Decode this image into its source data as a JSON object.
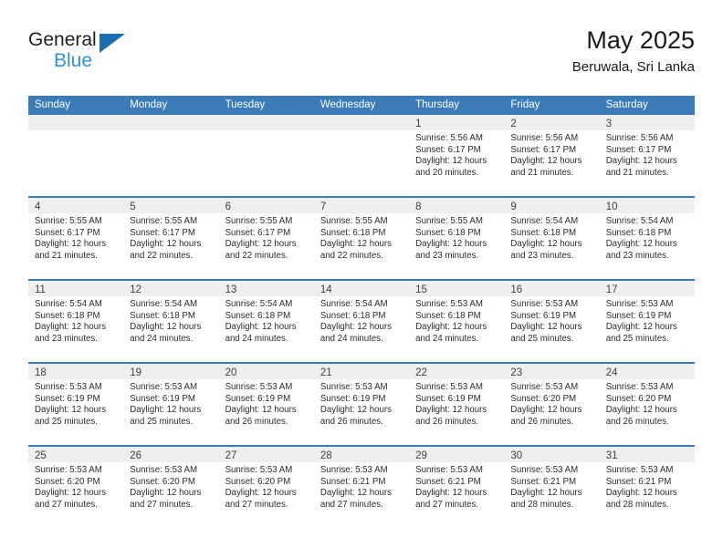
{
  "brand": {
    "line1": "General",
    "line2": "Blue",
    "triangle_color": "#1b6cb0",
    "blue_text_color": "#2e8fd6"
  },
  "header": {
    "title": "May 2025",
    "subtitle": "Beruwala, Sri Lanka"
  },
  "colors": {
    "header_row_bg": "#3b7cb8",
    "header_row_text": "#ffffff",
    "day_strip_bg": "#efefef",
    "cell_bg": "#ffffff",
    "body_text": "#2b2b2b"
  },
  "weekdays": [
    "Sunday",
    "Monday",
    "Tuesday",
    "Wednesday",
    "Thursday",
    "Friday",
    "Saturday"
  ],
  "weeks": [
    [
      {
        "day": "",
        "lines": []
      },
      {
        "day": "",
        "lines": []
      },
      {
        "day": "",
        "lines": []
      },
      {
        "day": "",
        "lines": []
      },
      {
        "day": "1",
        "lines": [
          "Sunrise: 5:56 AM",
          "Sunset: 6:17 PM",
          "Daylight: 12 hours",
          "and 20 minutes."
        ]
      },
      {
        "day": "2",
        "lines": [
          "Sunrise: 5:56 AM",
          "Sunset: 6:17 PM",
          "Daylight: 12 hours",
          "and 21 minutes."
        ]
      },
      {
        "day": "3",
        "lines": [
          "Sunrise: 5:56 AM",
          "Sunset: 6:17 PM",
          "Daylight: 12 hours",
          "and 21 minutes."
        ]
      }
    ],
    [
      {
        "day": "4",
        "lines": [
          "Sunrise: 5:55 AM",
          "Sunset: 6:17 PM",
          "Daylight: 12 hours",
          "and 21 minutes."
        ]
      },
      {
        "day": "5",
        "lines": [
          "Sunrise: 5:55 AM",
          "Sunset: 6:17 PM",
          "Daylight: 12 hours",
          "and 22 minutes."
        ]
      },
      {
        "day": "6",
        "lines": [
          "Sunrise: 5:55 AM",
          "Sunset: 6:17 PM",
          "Daylight: 12 hours",
          "and 22 minutes."
        ]
      },
      {
        "day": "7",
        "lines": [
          "Sunrise: 5:55 AM",
          "Sunset: 6:18 PM",
          "Daylight: 12 hours",
          "and 22 minutes."
        ]
      },
      {
        "day": "8",
        "lines": [
          "Sunrise: 5:55 AM",
          "Sunset: 6:18 PM",
          "Daylight: 12 hours",
          "and 23 minutes."
        ]
      },
      {
        "day": "9",
        "lines": [
          "Sunrise: 5:54 AM",
          "Sunset: 6:18 PM",
          "Daylight: 12 hours",
          "and 23 minutes."
        ]
      },
      {
        "day": "10",
        "lines": [
          "Sunrise: 5:54 AM",
          "Sunset: 6:18 PM",
          "Daylight: 12 hours",
          "and 23 minutes."
        ]
      }
    ],
    [
      {
        "day": "11",
        "lines": [
          "Sunrise: 5:54 AM",
          "Sunset: 6:18 PM",
          "Daylight: 12 hours",
          "and 23 minutes."
        ]
      },
      {
        "day": "12",
        "lines": [
          "Sunrise: 5:54 AM",
          "Sunset: 6:18 PM",
          "Daylight: 12 hours",
          "and 24 minutes."
        ]
      },
      {
        "day": "13",
        "lines": [
          "Sunrise: 5:54 AM",
          "Sunset: 6:18 PM",
          "Daylight: 12 hours",
          "and 24 minutes."
        ]
      },
      {
        "day": "14",
        "lines": [
          "Sunrise: 5:54 AM",
          "Sunset: 6:18 PM",
          "Daylight: 12 hours",
          "and 24 minutes."
        ]
      },
      {
        "day": "15",
        "lines": [
          "Sunrise: 5:53 AM",
          "Sunset: 6:18 PM",
          "Daylight: 12 hours",
          "and 24 minutes."
        ]
      },
      {
        "day": "16",
        "lines": [
          "Sunrise: 5:53 AM",
          "Sunset: 6:19 PM",
          "Daylight: 12 hours",
          "and 25 minutes."
        ]
      },
      {
        "day": "17",
        "lines": [
          "Sunrise: 5:53 AM",
          "Sunset: 6:19 PM",
          "Daylight: 12 hours",
          "and 25 minutes."
        ]
      }
    ],
    [
      {
        "day": "18",
        "lines": [
          "Sunrise: 5:53 AM",
          "Sunset: 6:19 PM",
          "Daylight: 12 hours",
          "and 25 minutes."
        ]
      },
      {
        "day": "19",
        "lines": [
          "Sunrise: 5:53 AM",
          "Sunset: 6:19 PM",
          "Daylight: 12 hours",
          "and 25 minutes."
        ]
      },
      {
        "day": "20",
        "lines": [
          "Sunrise: 5:53 AM",
          "Sunset: 6:19 PM",
          "Daylight: 12 hours",
          "and 26 minutes."
        ]
      },
      {
        "day": "21",
        "lines": [
          "Sunrise: 5:53 AM",
          "Sunset: 6:19 PM",
          "Daylight: 12 hours",
          "and 26 minutes."
        ]
      },
      {
        "day": "22",
        "lines": [
          "Sunrise: 5:53 AM",
          "Sunset: 6:19 PM",
          "Daylight: 12 hours",
          "and 26 minutes."
        ]
      },
      {
        "day": "23",
        "lines": [
          "Sunrise: 5:53 AM",
          "Sunset: 6:20 PM",
          "Daylight: 12 hours",
          "and 26 minutes."
        ]
      },
      {
        "day": "24",
        "lines": [
          "Sunrise: 5:53 AM",
          "Sunset: 6:20 PM",
          "Daylight: 12 hours",
          "and 26 minutes."
        ]
      }
    ],
    [
      {
        "day": "25",
        "lines": [
          "Sunrise: 5:53 AM",
          "Sunset: 6:20 PM",
          "Daylight: 12 hours",
          "and 27 minutes."
        ]
      },
      {
        "day": "26",
        "lines": [
          "Sunrise: 5:53 AM",
          "Sunset: 6:20 PM",
          "Daylight: 12 hours",
          "and 27 minutes."
        ]
      },
      {
        "day": "27",
        "lines": [
          "Sunrise: 5:53 AM",
          "Sunset: 6:20 PM",
          "Daylight: 12 hours",
          "and 27 minutes."
        ]
      },
      {
        "day": "28",
        "lines": [
          "Sunrise: 5:53 AM",
          "Sunset: 6:21 PM",
          "Daylight: 12 hours",
          "and 27 minutes."
        ]
      },
      {
        "day": "29",
        "lines": [
          "Sunrise: 5:53 AM",
          "Sunset: 6:21 PM",
          "Daylight: 12 hours",
          "and 27 minutes."
        ]
      },
      {
        "day": "30",
        "lines": [
          "Sunrise: 5:53 AM",
          "Sunset: 6:21 PM",
          "Daylight: 12 hours",
          "and 28 minutes."
        ]
      },
      {
        "day": "31",
        "lines": [
          "Sunrise: 5:53 AM",
          "Sunset: 6:21 PM",
          "Daylight: 12 hours",
          "and 28 minutes."
        ]
      }
    ]
  ]
}
